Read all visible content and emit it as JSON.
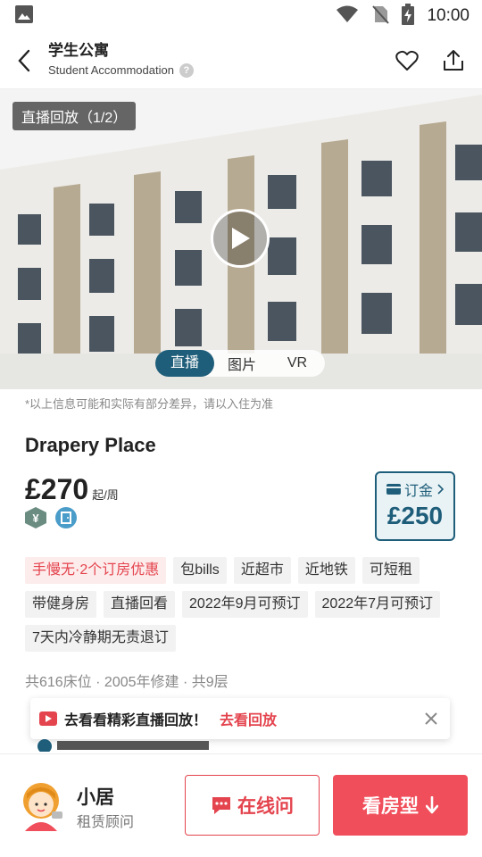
{
  "status_bar": {
    "time": "10:00"
  },
  "header": {
    "title_cn": "学生公寓",
    "title_en": "Student Accommodation",
    "help_symbol": "?"
  },
  "hero": {
    "live_tag": "直播回放（1/2）",
    "tabs": [
      {
        "label": "直播"
      },
      {
        "label": "图片"
      },
      {
        "label": "VR"
      }
    ]
  },
  "disclaimer": "*以上信息可能和实际有部分差异，请以入住为准",
  "property": {
    "name": "Drapery Place",
    "price": "£270",
    "price_unit": "起/周",
    "badge_money": "¥",
    "deposit_label": "订金",
    "deposit_amount": "£250",
    "tags": [
      {
        "text": "手慢无·2个订房优惠",
        "promo": true
      },
      {
        "text": "包bills"
      },
      {
        "text": "近超市"
      },
      {
        "text": "近地铁"
      },
      {
        "text": "可短租"
      },
      {
        "text": "带健身房"
      },
      {
        "text": "直播回看"
      },
      {
        "text": "2022年9月可预订"
      },
      {
        "text": "2022年7月可预订"
      },
      {
        "text": "7天内冷静期无责退订"
      }
    ],
    "meta": "共616床位 · 2005年修建 · 共9层"
  },
  "toast": {
    "message": "去看看精彩直播回放！",
    "link": "去看回放"
  },
  "bottom_bar": {
    "agent_name": "小居",
    "agent_role": "租赁顾问",
    "ask_label": "在线问",
    "rooms_label": "看房型"
  },
  "colors": {
    "accent_red": "#f04e5a",
    "brand_teal": "#1f5e7a"
  }
}
